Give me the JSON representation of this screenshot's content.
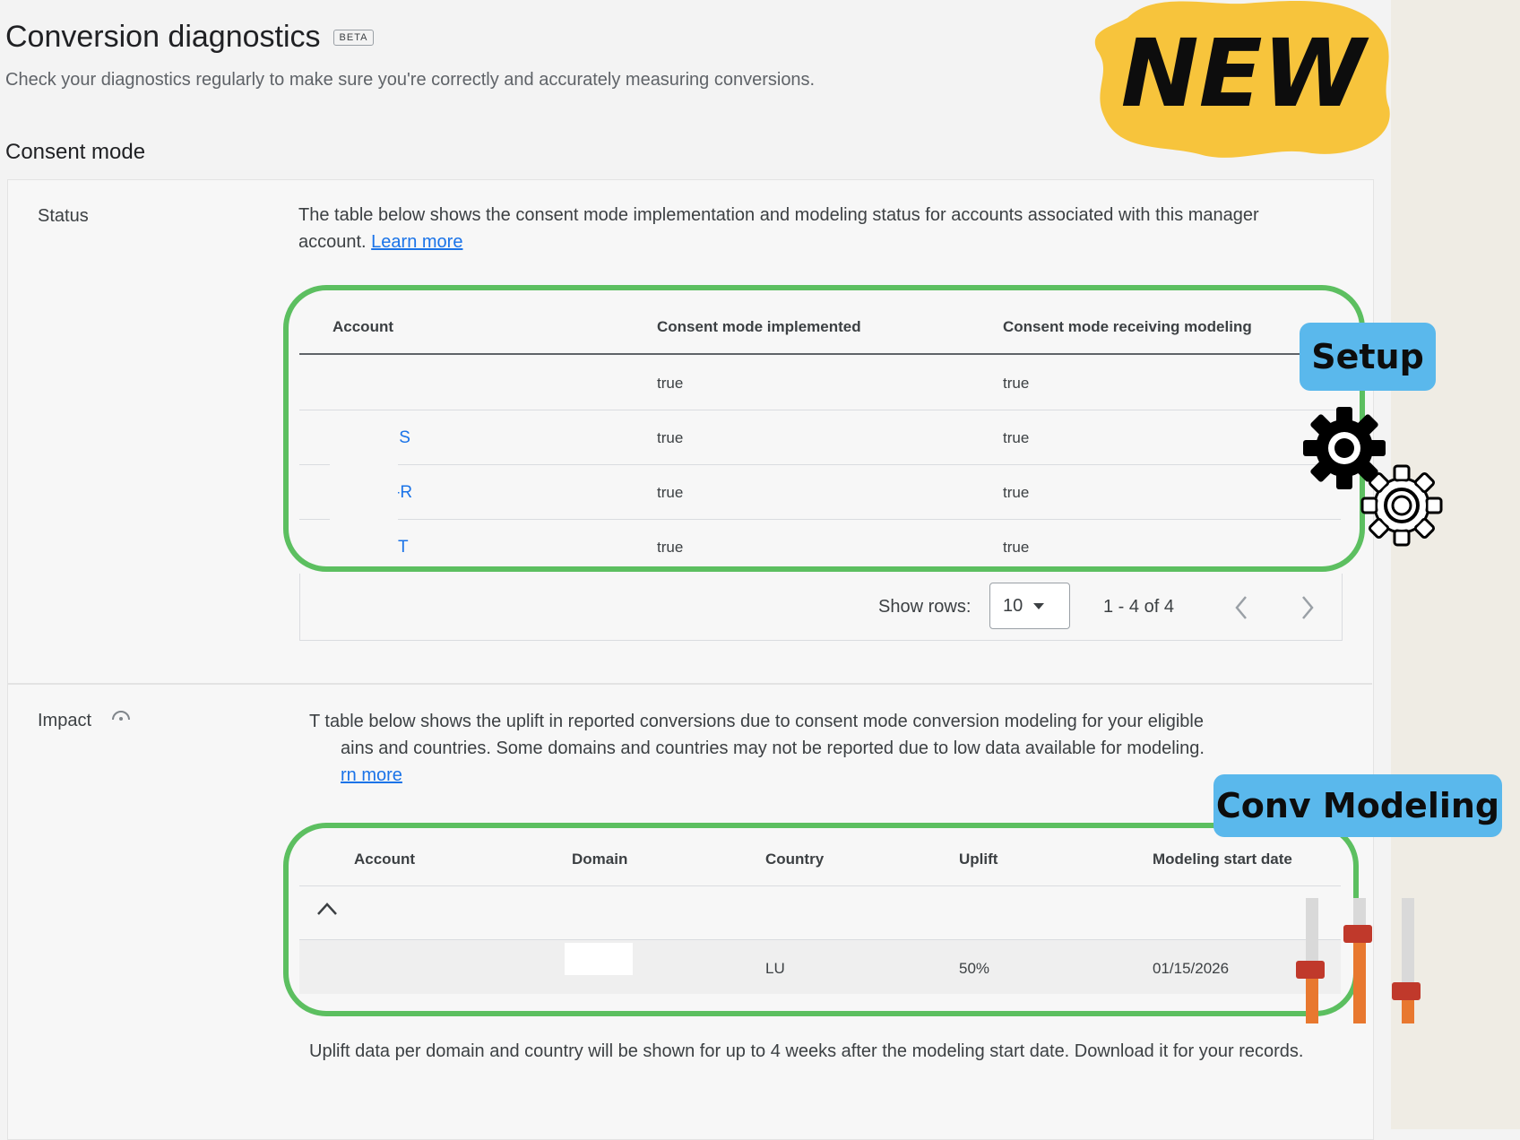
{
  "header": {
    "title": "Conversion diagnostics",
    "badge": "BETA",
    "subtitle": "Check your diagnostics regularly to make sure you're correctly and accurately measuring conversions."
  },
  "consent_mode": {
    "section_title": "Consent mode",
    "status": {
      "label": "Status",
      "description": "The table below shows the consent mode implementation and modeling status for accounts associated with this manager account.",
      "learn_more": "Learn more",
      "columns": [
        "Account",
        "Consent mode implemented",
        "Consent mode receiving modeling"
      ],
      "rows": [
        {
          "account": "",
          "implemented": "true",
          "modeling": "true"
        },
        {
          "account": ":S",
          "implemented": "true",
          "modeling": "true"
        },
        {
          "account": "-R",
          "implemented": "true",
          "modeling": "true"
        },
        {
          "account": "T",
          "implemented": "true",
          "modeling": "true"
        }
      ],
      "pagination": {
        "show_rows_label": "Show rows:",
        "rows_value": "10",
        "range": "1 - 4 of 4"
      }
    },
    "impact": {
      "label": "Impact",
      "description_line1": "T  table below shows the uplift in reported conversions due to consent mode conversion modeling for your eligible",
      "description_line2": "ains and countries. Some domains and countries may not be reported due to low data available for modeling.",
      "learn_more": "rn more",
      "columns": [
        "Account",
        "Domain",
        "Country",
        "Uplift",
        "Modeling start date"
      ],
      "rows": [
        {
          "account": "",
          "domain": "",
          "country": "LU",
          "uplift": "50%",
          "start_date": "01/15/2026"
        }
      ],
      "footnote": "Uplift data per domain and country will be shown for up to 4 weeks after the modeling start date. Download it for your records."
    }
  },
  "overlays": {
    "new_sticker": "NEW",
    "setup_tag": "Setup",
    "conv_modeling_tag": "Conv Modeling",
    "highlight_color": "#5cbf60",
    "tag_color": "#5ab8ec",
    "sticker_color": "#f7c43c"
  }
}
